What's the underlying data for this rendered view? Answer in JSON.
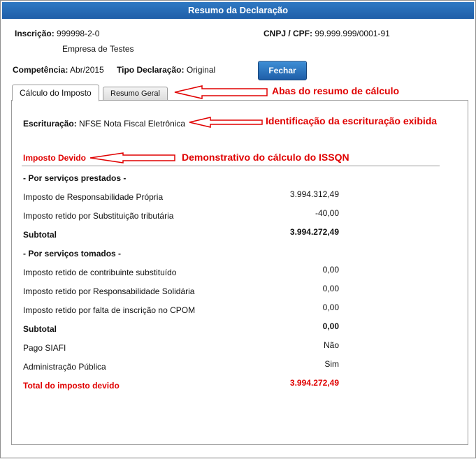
{
  "dialog": {
    "title": "Resumo da Declaração",
    "close_button": "Fechar"
  },
  "header": {
    "inscricao_label": "Inscrição:",
    "inscricao_value": "999998-2-0",
    "company_name": "Empresa de Testes",
    "cnpj_label": "CNPJ / CPF:",
    "cnpj_value": "99.999.999/0001-91",
    "competencia_label": "Competência:",
    "competencia_value": "Abr/2015",
    "tipo_label": "Tipo Declaração:",
    "tipo_value": "Original"
  },
  "tabs": [
    {
      "label": "Cálculo do Imposto",
      "active": true
    },
    {
      "label": "Resumo Geral",
      "active": false
    }
  ],
  "escrituracao": {
    "label": "Escrituração:",
    "value": "NFSE Nota Fiscal Eletrônica"
  },
  "section_title": "Imposto Devido",
  "prestados": {
    "heading": "- Por serviços prestados -",
    "rows": [
      {
        "label": "Imposto de Responsabilidade Própria",
        "value": "3.994.312,49"
      },
      {
        "label": "Imposto retido por Substituição tributária",
        "value": "-40,00"
      }
    ],
    "subtotal_label": "Subtotal",
    "subtotal_value": "3.994.272,49"
  },
  "tomados": {
    "heading": "- Por serviços tomados -",
    "rows": [
      {
        "label": "Imposto retido de contribuinte substituído",
        "value": "0,00"
      },
      {
        "label": "Imposto retido por Responsabilidade Solidária",
        "value": "0,00"
      },
      {
        "label": "Imposto retido por falta de inscrição no CPOM",
        "value": "0,00"
      }
    ],
    "subtotal_label": "Subtotal",
    "subtotal_value": "0,00"
  },
  "extra": [
    {
      "label": "Pago SIAFI",
      "value": "Não"
    },
    {
      "label": "Administração Pública",
      "value": "Sim"
    }
  ],
  "total": {
    "label": "Total do imposto devido",
    "value": "3.994.272,49"
  },
  "annotations": {
    "tabs": "Abas do resumo de cálculo",
    "escrituracao": "Identificação da escrituração exibida",
    "calculo": "Demonstrativo do cálculo do ISSQN"
  },
  "colors": {
    "title_bar": "#1f5ea8",
    "annotation": "#e00000",
    "total": "#e00000"
  }
}
